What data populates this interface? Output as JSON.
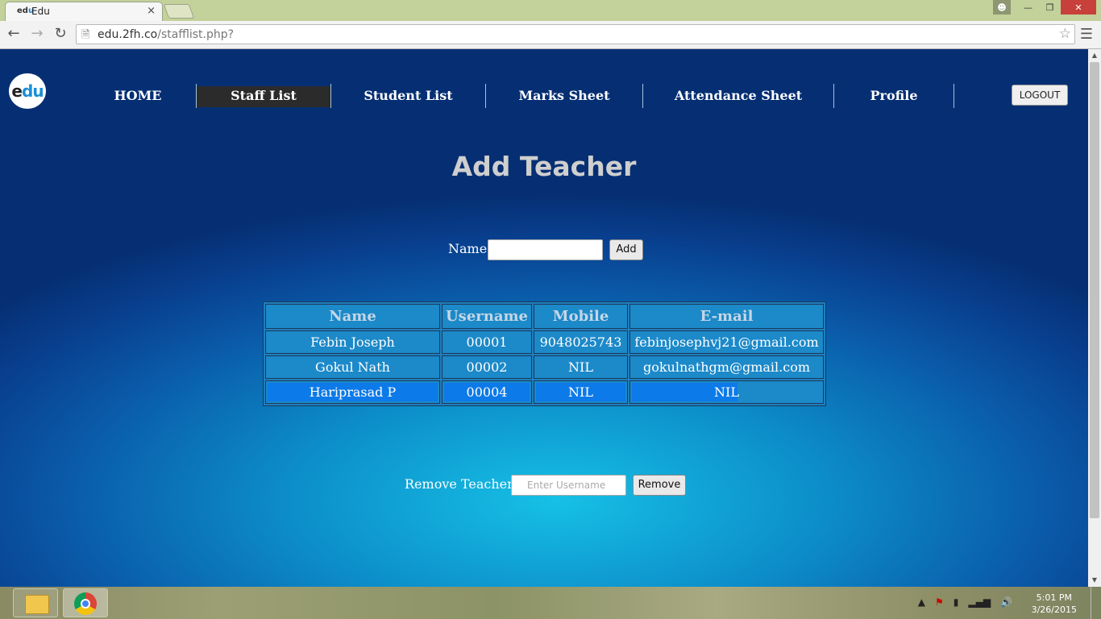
{
  "browser": {
    "tab_title": "Edu",
    "tab_favicon_text": "edu",
    "tab_close": "×",
    "url_host": "edu.2fh.co",
    "url_path": "/stafflist.php?"
  },
  "nav": {
    "logo_e": "e",
    "logo_u": "du",
    "items": [
      "HOME",
      "Staff List",
      "Student List",
      "Marks Sheet",
      "Attendance Sheet",
      "Profile"
    ],
    "active": "Staff List",
    "logout_label": "LOGOUT"
  },
  "page": {
    "heading": "Add Teacher",
    "add_form": {
      "label": "Name",
      "value": "",
      "button": "Add"
    },
    "table": {
      "headers": [
        "Name",
        "Username",
        "Mobile",
        "E-mail"
      ],
      "rows": [
        [
          "Febin Joseph",
          "00001",
          "9048025743",
          "febinjosephvj21@gmail.com"
        ],
        [
          "Gokul Nath",
          "00002",
          "NIL",
          "gokulnathgm@gmail.com"
        ],
        [
          "Hariprasad P",
          "00004",
          "NIL",
          "NIL"
        ]
      ]
    },
    "remove_form": {
      "label": "Remove Teacher",
      "placeholder": "Enter Username",
      "button": "Remove"
    }
  },
  "taskbar": {
    "time": "5:01 PM",
    "date": "3/26/2015"
  },
  "colors": {
    "nav_active_bg": "#2b2b2b",
    "table_cell_bg": "#1c89c9",
    "selection_highlight": "#0c7ae8"
  }
}
